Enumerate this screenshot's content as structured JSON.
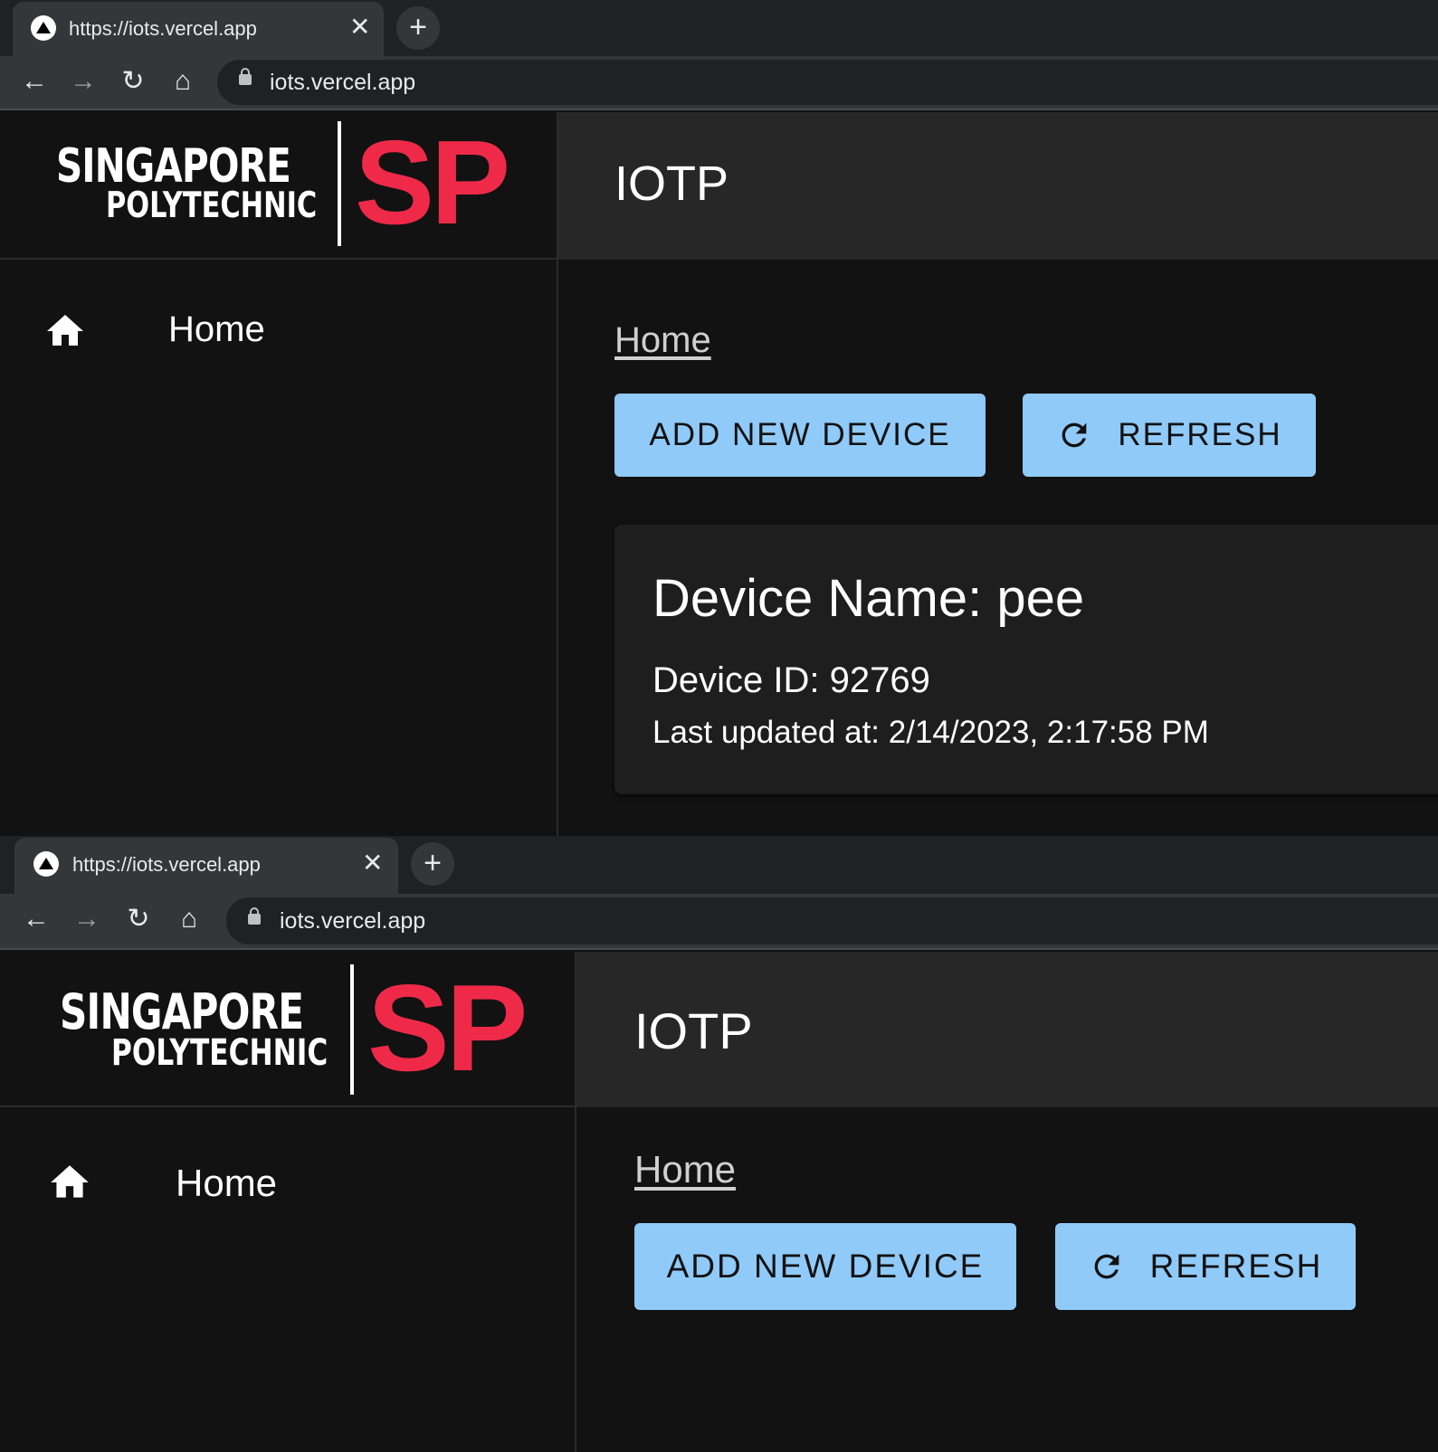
{
  "browser": {
    "tab_title": "https://iots.vercel.app",
    "tab_close": "✕",
    "new_tab": "+",
    "url": "iots.vercel.app",
    "back": "←",
    "forward": "→",
    "reload": "↻",
    "home": "⌂"
  },
  "logo": {
    "line1": "SINGAPORE",
    "line2": "POLYTECHNIC",
    "mark": "SP",
    "mark_color": "#ee2a48"
  },
  "app": {
    "title": "IOTP"
  },
  "sidebar": {
    "items": [
      {
        "label": "Home",
        "icon": "home-icon"
      }
    ]
  },
  "main": {
    "breadcrumb": "Home",
    "add_button": "ADD NEW DEVICE",
    "refresh_button": "REFRESH",
    "button_color": "#90caf9"
  },
  "devices": [
    {
      "name_text": "Device Name: pee",
      "id_text": "Device ID: 92769",
      "updated_text": "Last updated at: 2/14/2023, 2:17:58 PM"
    }
  ]
}
